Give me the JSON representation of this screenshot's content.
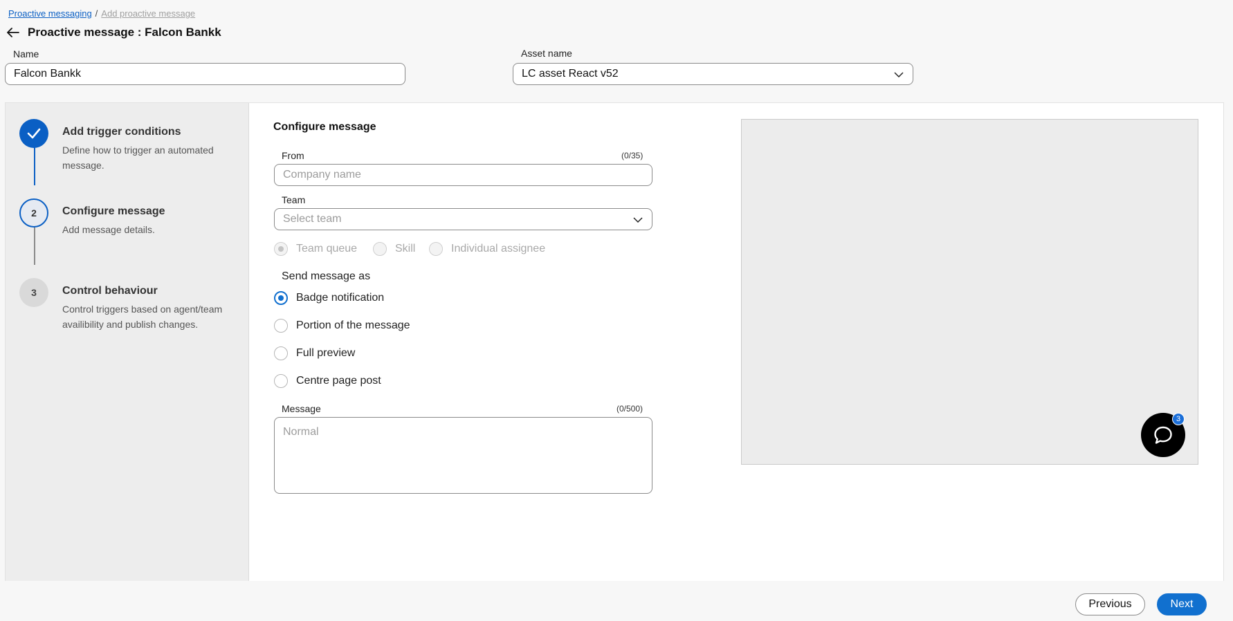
{
  "breadcrumb": {
    "parent": "Proactive messaging",
    "separator": "/",
    "current": "Add proactive message"
  },
  "header": {
    "title": "Proactive message : Falcon Bankk"
  },
  "top_form": {
    "name_label": "Name",
    "name_value": "Falcon Bankk",
    "asset_label": "Asset name",
    "asset_value": "LC asset React v52"
  },
  "stepper": {
    "steps": [
      {
        "number": "",
        "status": "completed",
        "title": "Add trigger conditions",
        "description": "Define how to trigger an automated message."
      },
      {
        "number": "2",
        "status": "active",
        "title": "Configure message",
        "description": "Add message details."
      },
      {
        "number": "3",
        "status": "pending",
        "title": "Control behaviour",
        "description": "Control triggers based on agent/team availibility and publish changes."
      }
    ]
  },
  "configure": {
    "section_title": "Configure message",
    "from_label": "From",
    "from_counter": "(0/35)",
    "from_placeholder": "Company name",
    "team_label": "Team",
    "team_placeholder": "Select team",
    "routing_options": [
      {
        "label": "Team queue",
        "checked": true,
        "disabled": true
      },
      {
        "label": "Skill",
        "checked": false,
        "disabled": true
      },
      {
        "label": "Individual assignee",
        "checked": false,
        "disabled": true
      }
    ],
    "send_as_label": "Send message as",
    "send_as_options": [
      {
        "label": "Badge notification",
        "checked": true
      },
      {
        "label": "Portion of the message",
        "checked": false
      },
      {
        "label": "Full preview",
        "checked": false
      },
      {
        "label": "Centre page post",
        "checked": false
      }
    ],
    "message_label": "Message",
    "message_counter": "(0/500)",
    "message_placeholder": "Normal"
  },
  "preview": {
    "badge_count": "3"
  },
  "footer": {
    "previous_label": "Previous",
    "next_label": "Next"
  },
  "colors": {
    "accent": "#1170cf",
    "stepper_bg": "#ededed",
    "page_bg": "#f7f7f7"
  }
}
